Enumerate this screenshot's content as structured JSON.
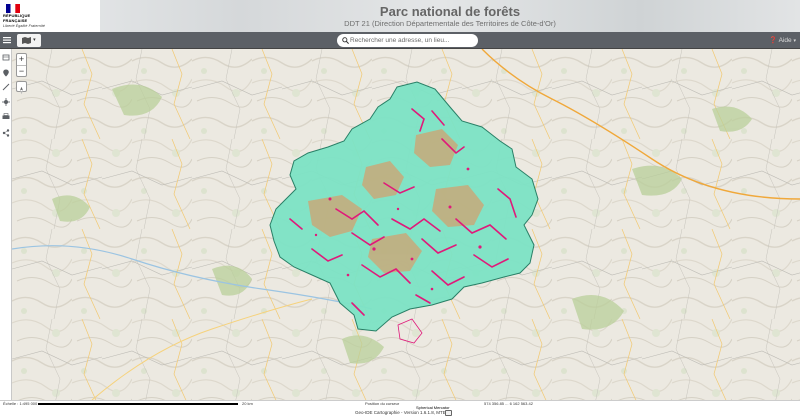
{
  "header": {
    "logo": {
      "line1": "RÉPUBLIQUE",
      "line2": "FRANÇAISE",
      "motto": "Liberté Égalité Fraternité"
    },
    "title": "Parc national de forêts",
    "subtitle": "DDT 21 (Direction Départementale des Territoires de Côte-d'Or)"
  },
  "toolbar": {
    "menu_icon": "menu-icon",
    "basemap_icon": "map-layers-icon",
    "search_placeholder": "Rechercher une adresse, un lieu...",
    "help_label": "Aide"
  },
  "side_panel": {
    "icons": [
      "layers-icon",
      "location-pin-icon",
      "draw-icon",
      "target-icon",
      "print-icon",
      "share-icon"
    ]
  },
  "map": {
    "park_fill": "#7de3c5",
    "park_stroke": "#1f7a60",
    "forest_fill": "#c4ad7e",
    "reserve_color": "#e0197a"
  },
  "status_bar": {
    "scale_label": "Échelle : 1:495 000",
    "scale_end": "20 km",
    "position_label": "Position du curseur",
    "projection": "Spherical Mercator",
    "coords": "574 356.85 ... 6 162 563.42",
    "version": "Geo-IDE Cartographie - Version 1.6.1.8, MTES"
  }
}
